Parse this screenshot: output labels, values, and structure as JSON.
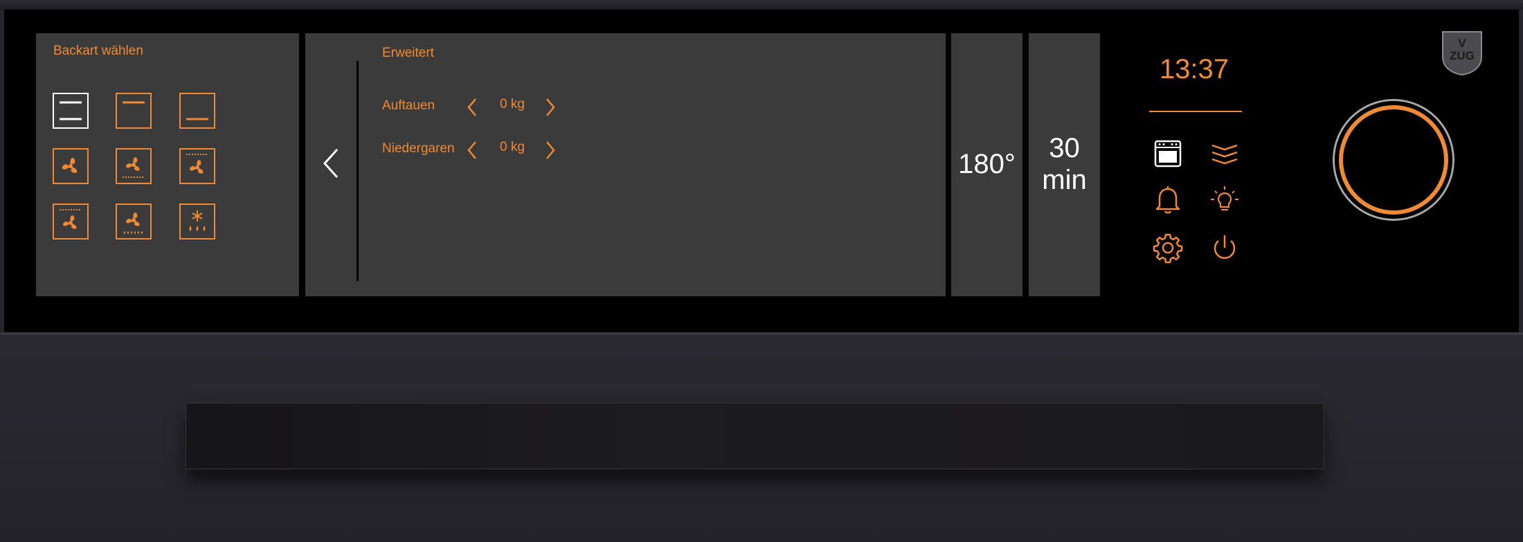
{
  "backart_panel": {
    "title": "Backart wählen",
    "modes": [
      {
        "name": "top-bottom-heat",
        "selected": true
      },
      {
        "name": "top-heat",
        "selected": false
      },
      {
        "name": "bottom-heat",
        "selected": false
      },
      {
        "name": "hot-air",
        "selected": false
      },
      {
        "name": "hot-air-bottom-heat",
        "selected": false
      },
      {
        "name": "hot-air-top-heat",
        "selected": false
      },
      {
        "name": "hot-air-humid",
        "selected": false
      },
      {
        "name": "pizza-plus",
        "selected": false
      },
      {
        "name": "defrost-steam",
        "selected": false
      }
    ]
  },
  "erweitert_panel": {
    "title": "Erweitert",
    "rows": [
      {
        "label": "Auftauen",
        "value": "0 kg"
      },
      {
        "label": "Niedergaren",
        "value": "0 kg"
      }
    ]
  },
  "temperature": {
    "value": "180°"
  },
  "duration": {
    "value": "30",
    "unit": "min"
  },
  "clock": {
    "time": "13:37"
  },
  "side_icons": [
    "oven-icon",
    "layers-icon",
    "bell-icon",
    "light-icon",
    "settings-icon",
    "power-icon"
  ],
  "brand": {
    "logo_text_top": "V",
    "logo_text_bottom": "ZUG"
  },
  "colors": {
    "accent": "#f08a36",
    "screen": "#3b3b3b",
    "panel": "#000000",
    "selected": "#ffffff"
  }
}
